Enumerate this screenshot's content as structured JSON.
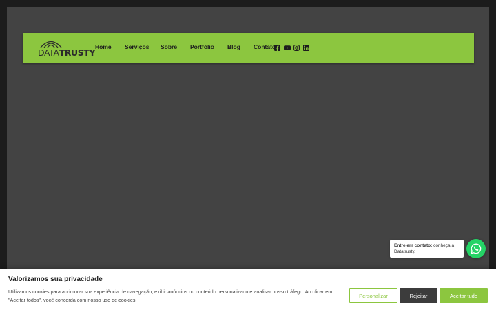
{
  "brand": {
    "logo_thin": "DATA",
    "logo_bold": "TRUSTY",
    "color": "#8cc63f"
  },
  "nav": {
    "items": [
      {
        "label": "Home"
      },
      {
        "label": "Serviços"
      },
      {
        "label": "Sobre"
      },
      {
        "label": "Portfólio"
      },
      {
        "label": "Blog"
      },
      {
        "label": "Contato"
      }
    ],
    "social_icons": [
      "facebook-icon",
      "youtube-icon",
      "instagram-icon",
      "linkedin-icon"
    ]
  },
  "whatsapp": {
    "bubble_bold": "Entre em contato:",
    "bubble_text": " conheça a Datatrusty.",
    "icon": "whatsapp-icon",
    "color": "#25d366"
  },
  "cookie": {
    "title": "Valorizamos sua privacidade",
    "text": "Utilizamos cookies para aprimorar sua experiência de navegação, exibir anúncios ou conteúdo personalizado e analisar nosso tráfego. Ao clicar em \"Aceitar todos\", você concorda com nosso uso de cookies.",
    "customize_label": "Personalizar",
    "reject_label": "Rejeitar",
    "accept_label": "Aceitar tudo"
  }
}
